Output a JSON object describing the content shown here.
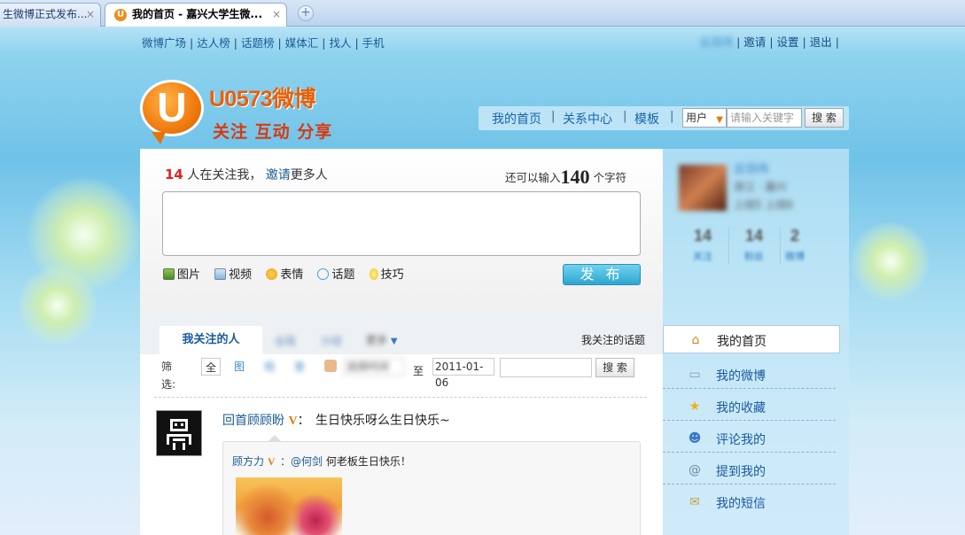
{
  "browser": {
    "tabs": [
      {
        "title": "生微博正式发布...",
        "close": "×"
      },
      {
        "title": "我的首页 - 嘉兴大学生微...",
        "close": "×",
        "favicon": "U"
      }
    ],
    "new_tab": "+"
  },
  "top_nav": {
    "links": [
      "微博广场",
      "达人榜",
      "话题榜",
      "媒体汇",
      "找人",
      "手机"
    ],
    "user_links": [
      "邀请",
      "设置",
      "退出"
    ],
    "username_blurred": "云羽鸿"
  },
  "logo": {
    "letter": "U",
    "title": "U0573微博",
    "slogan": "关注 互动 分享"
  },
  "main_nav": {
    "items": [
      "我的首页",
      "关系中心",
      "模板"
    ]
  },
  "search": {
    "type": "用户",
    "placeholder": "请输入关键字",
    "button": "搜 索"
  },
  "composer": {
    "followers_count": "14",
    "followers_text": "人在关注我，",
    "invite_link": "邀请",
    "invite_suffix": "更多人",
    "chars_prefix": "还可以输入",
    "chars_left": "140",
    "chars_suffix": "个字符",
    "tools": [
      "图片",
      "视频",
      "表情",
      "话题",
      "技巧"
    ],
    "publish": "发 布"
  },
  "feed": {
    "tabs": [
      "我关注的人",
      "@我",
      "分组",
      "更多"
    ],
    "topic_link": "我关注的话题",
    "filter_label": "筛选:",
    "filters": [
      "全",
      "图",
      "视",
      "音"
    ],
    "date_start": "选择时间",
    "date_to": "至",
    "date_end": "2011-01-06",
    "search_button": "搜 索",
    "post": {
      "author": "回首顾顾盼",
      "badge": "V",
      "colon": "：",
      "text": "生日快乐呀么生日快乐~",
      "quote": {
        "author": "顾方力",
        "badge": "V",
        "mention": "：@何剑",
        "text": "何老板生日快乐！"
      }
    }
  },
  "sidebar": {
    "name": "云羽鸿",
    "info1": "浙江 · 嘉兴",
    "info2": "上线5 上线6",
    "stats": [
      {
        "num": "14",
        "label": "关注"
      },
      {
        "num": "14",
        "label": "粉丝"
      },
      {
        "num": "2",
        "label": "微博"
      }
    ],
    "menu": [
      {
        "label": "我的首页",
        "icon": "home-icon"
      },
      {
        "label": "我的微博",
        "icon": "speech-bubble-icon"
      },
      {
        "label": "我的收藏",
        "icon": "star-icon"
      },
      {
        "label": "评论我的",
        "icon": "comment-user-icon"
      },
      {
        "label": "提到我的",
        "icon": "at-icon"
      },
      {
        "label": "我的短信",
        "icon": "envelope-icon"
      }
    ]
  },
  "colors": {
    "accent": "#1a5b96",
    "brand_orange": "#f07b0e",
    "highlight_red": "#e62020",
    "publish_blue": "#2ea6cf"
  }
}
